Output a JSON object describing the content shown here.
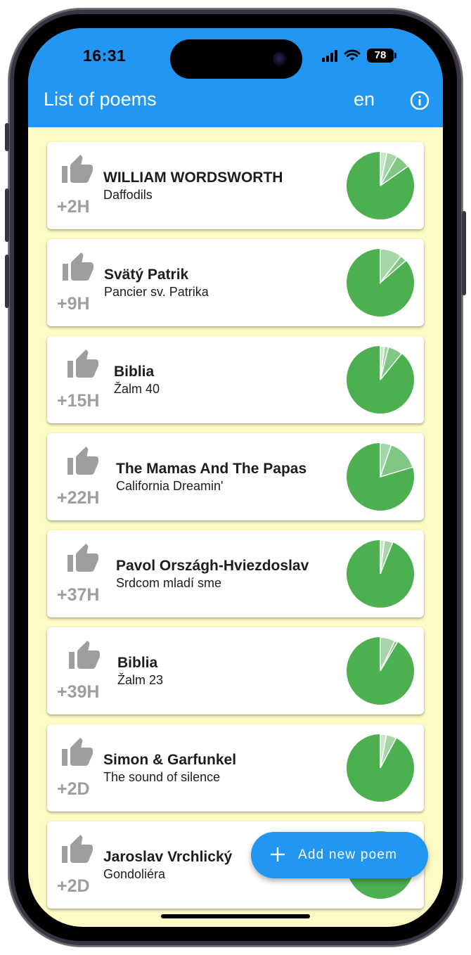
{
  "status_bar": {
    "time": "16:31",
    "battery": "78"
  },
  "appbar": {
    "title": "List of poems",
    "language": "en",
    "info_icon": "info-icon"
  },
  "colors": {
    "primary": "#2196f3",
    "background": "#fdfcc4",
    "pie_main": "#4caf50",
    "pie_light": "#a5d6a7",
    "pie_mid": "#81c784",
    "muted": "#9e9e9e"
  },
  "poems": [
    {
      "author": "WILLIAM WORDSWORTH",
      "title": "Daffodils",
      "age": "+2H"
    },
    {
      "author": "Svätý Patrik",
      "title": "Pancier sv. Patrika",
      "age": "+9H"
    },
    {
      "author": "Biblia",
      "title": "Žalm 40",
      "age": "+15H"
    },
    {
      "author": "The Mamas And The Papas",
      "title": "California Dreamin'",
      "age": "+22H"
    },
    {
      "author": "Pavol Országh-Hviezdoslav",
      "title": "Srdcom mladí sme",
      "age": "+37H"
    },
    {
      "author": "Biblia",
      "title": "Žalm 23",
      "age": "+39H"
    },
    {
      "author": "Simon & Garfunkel",
      "title": "The sound of silence",
      "age": "+2D"
    },
    {
      "author": "Jaroslav Vrchlický",
      "title": "Gondoliéra",
      "age": "+2D"
    }
  ],
  "fab": {
    "label": "Add new poem",
    "icon": "plus-icon"
  }
}
